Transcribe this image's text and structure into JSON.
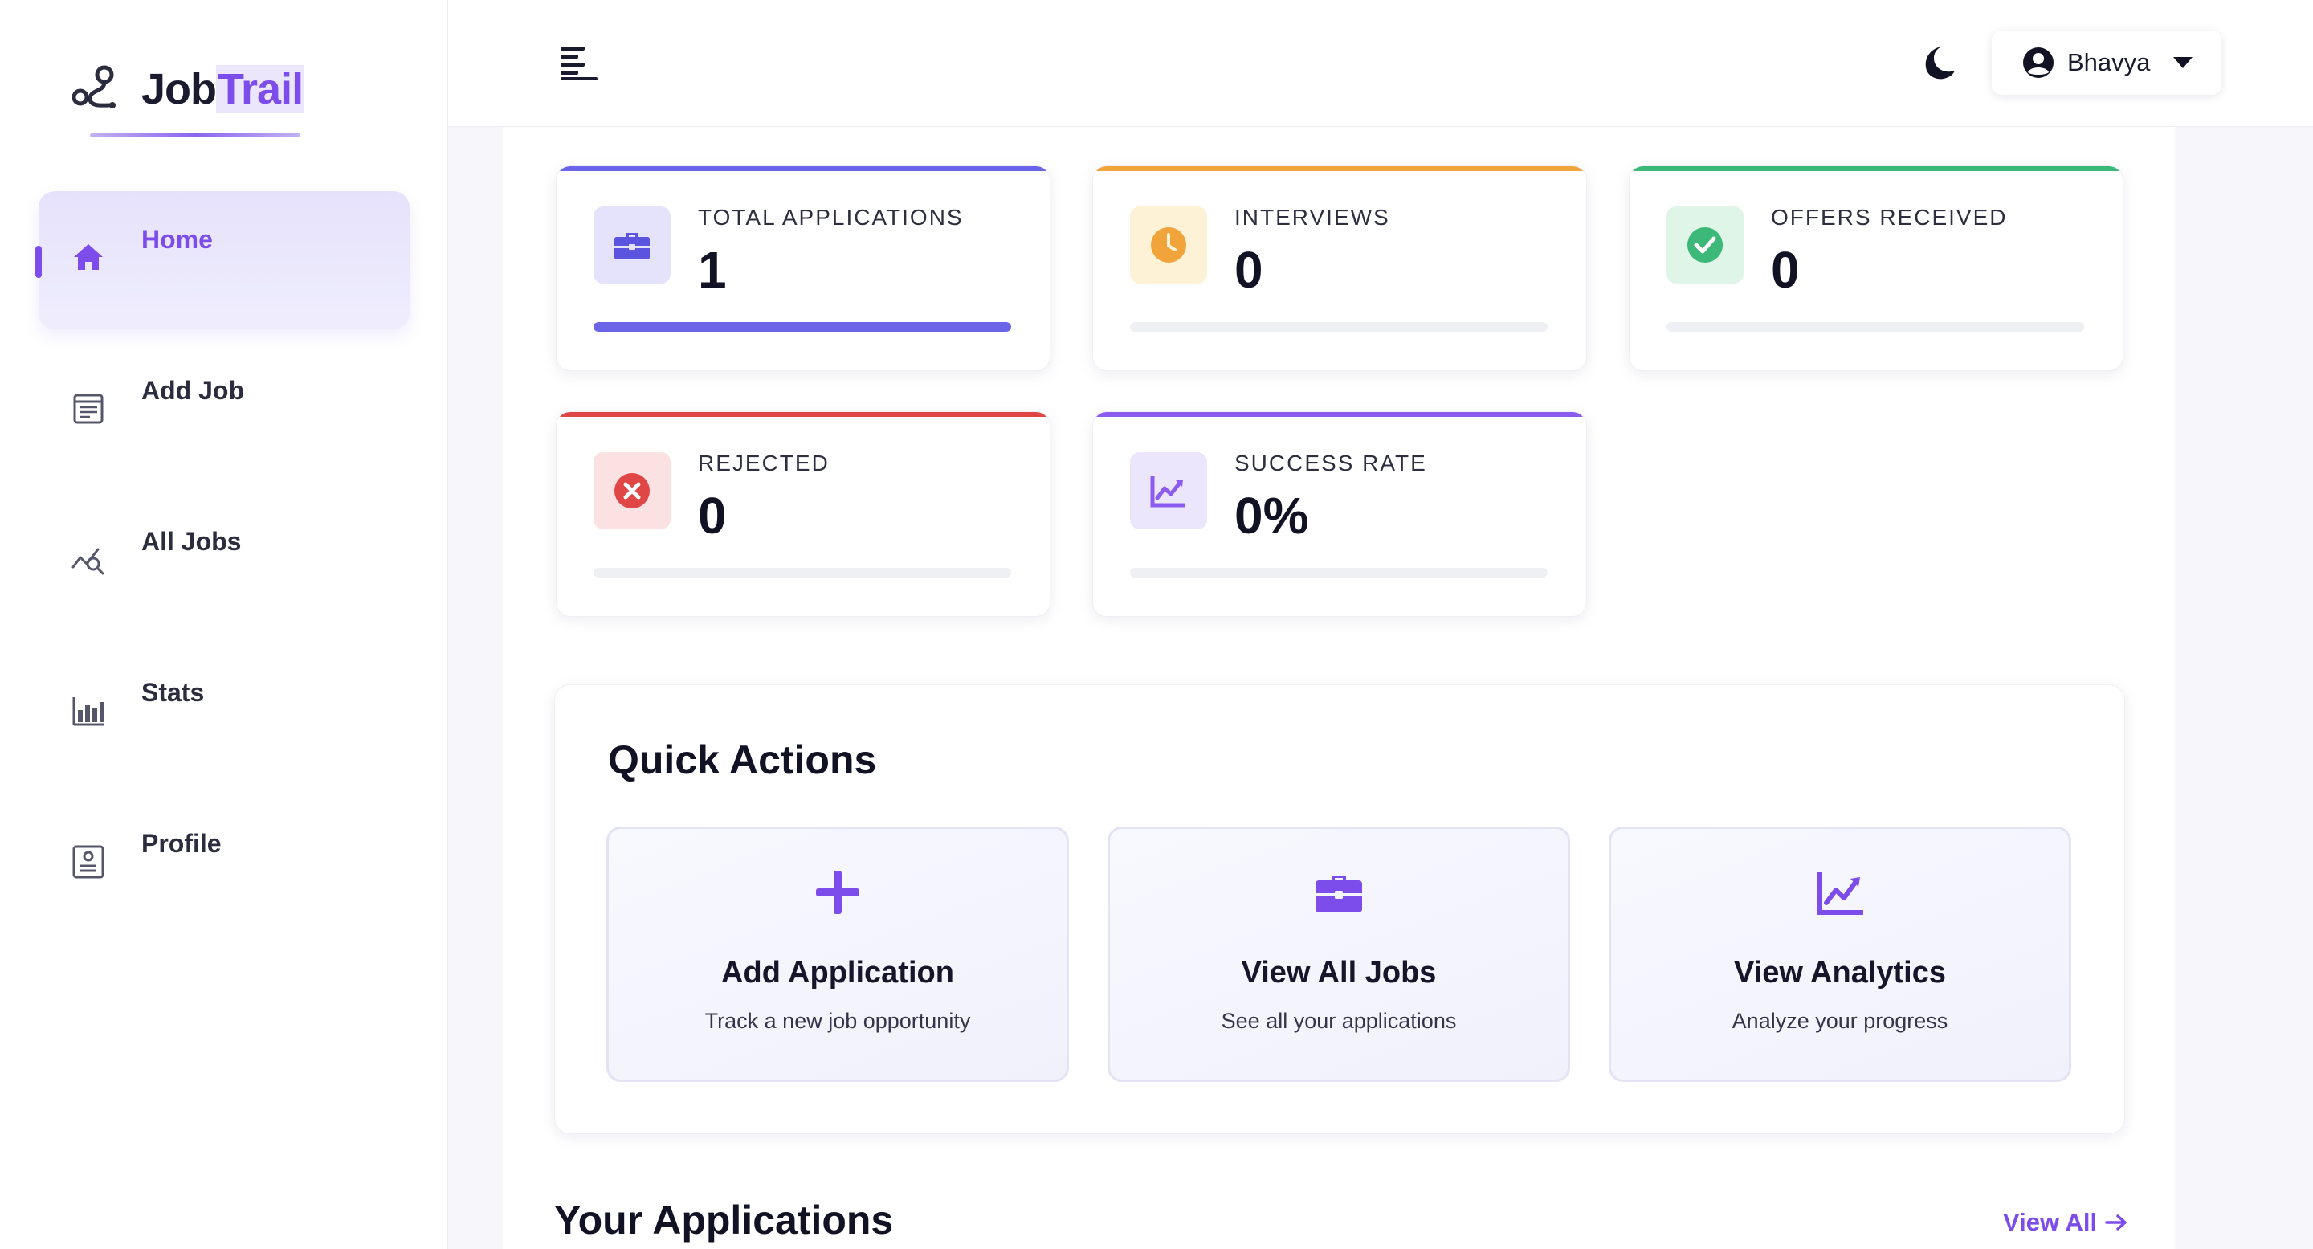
{
  "app": {
    "logo_part1": "Job",
    "logo_part2": "Trail"
  },
  "sidebar": {
    "items": [
      {
        "label": "Home",
        "icon": "home-icon",
        "active": true
      },
      {
        "label": "Add Job",
        "icon": "add-job-icon",
        "active": false
      },
      {
        "label": "All Jobs",
        "icon": "all-jobs-icon",
        "active": false
      },
      {
        "label": "Stats",
        "icon": "stats-icon",
        "active": false
      },
      {
        "label": "Profile",
        "icon": "profile-icon",
        "active": false
      }
    ]
  },
  "header": {
    "user_name": "Bhavya"
  },
  "stats": [
    {
      "label": "TOTAL APPLICATIONS",
      "value": "1",
      "icon": "briefcase-icon",
      "accent": "#6b63e8",
      "icon_bg": "#e4e3fb",
      "progress": 1.0
    },
    {
      "label": "INTERVIEWS",
      "value": "0",
      "icon": "clock-icon",
      "accent": "#f0a43a",
      "icon_bg": "#fdf1d6",
      "progress": 0
    },
    {
      "label": "OFFERS RECEIVED",
      "value": "0",
      "icon": "check-circle-icon",
      "accent": "#3cb878",
      "icon_bg": "#dff5e8",
      "progress": 0
    },
    {
      "label": "REJECTED",
      "value": "0",
      "icon": "x-circle-icon",
      "accent": "#e04646",
      "icon_bg": "#fbe1e1",
      "progress": 0
    },
    {
      "label": "SUCCESS RATE",
      "value": "0%",
      "icon": "chart-line-icon",
      "accent": "#8c5cf0",
      "icon_bg": "#ece6fd",
      "progress": 0
    }
  ],
  "quick_actions": {
    "title": "Quick Actions",
    "items": [
      {
        "title": "Add Application",
        "subtitle": "Track a new job opportunity",
        "icon": "plus-icon"
      },
      {
        "title": "View All Jobs",
        "subtitle": "See all your applications",
        "icon": "briefcase-icon"
      },
      {
        "title": "View Analytics",
        "subtitle": "Analyze your progress",
        "icon": "chart-line-icon"
      }
    ]
  },
  "applications": {
    "title": "Your Applications",
    "view_all_label": "View All"
  },
  "colors": {
    "brand": "#7c4dea"
  }
}
